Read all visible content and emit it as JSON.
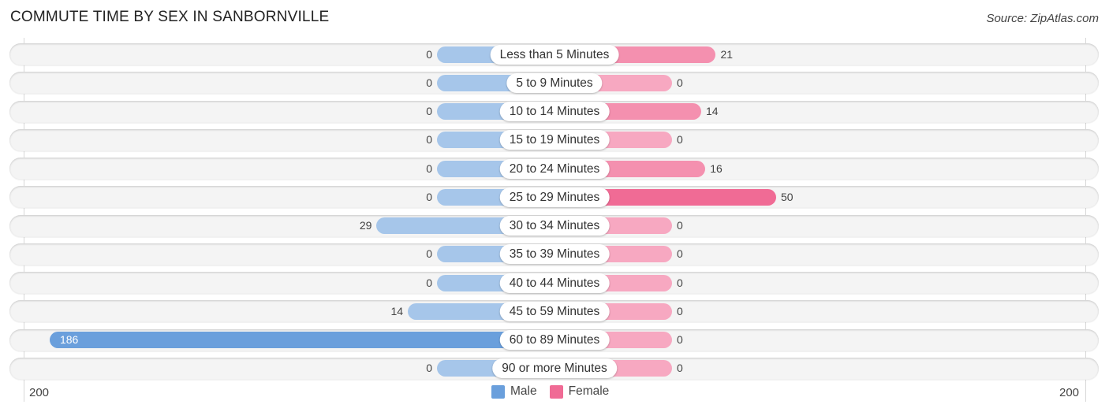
{
  "title": "COMMUTE TIME BY SEX IN SANBORNVILLE",
  "source": "Source: ZipAtlas.com",
  "colors": {
    "male": "#6a9fdc",
    "male_light": "#a6c6ea",
    "female": "#f06b95",
    "female_light": "#f7a8c1"
  },
  "chart_data": {
    "type": "bar",
    "orientation": "horizontal-diverging",
    "title": "COMMUTE TIME BY SEX IN SANBORNVILLE",
    "categories": [
      "Less than 5 Minutes",
      "5 to 9 Minutes",
      "10 to 14 Minutes",
      "15 to 19 Minutes",
      "20 to 24 Minutes",
      "25 to 29 Minutes",
      "30 to 34 Minutes",
      "35 to 39 Minutes",
      "40 to 44 Minutes",
      "45 to 59 Minutes",
      "60 to 89 Minutes",
      "90 or more Minutes"
    ],
    "series": [
      {
        "name": "Male",
        "values": [
          0,
          0,
          0,
          0,
          0,
          0,
          29,
          0,
          0,
          14,
          186,
          0
        ]
      },
      {
        "name": "Female",
        "values": [
          21,
          0,
          14,
          0,
          16,
          50,
          0,
          0,
          0,
          0,
          0,
          0
        ]
      }
    ],
    "xlim": [
      -200,
      200
    ],
    "axis_labels": {
      "left": "200",
      "right": "200"
    },
    "legend": {
      "position": "bottom-center",
      "entries": [
        "Male",
        "Female"
      ]
    },
    "grid": false
  }
}
